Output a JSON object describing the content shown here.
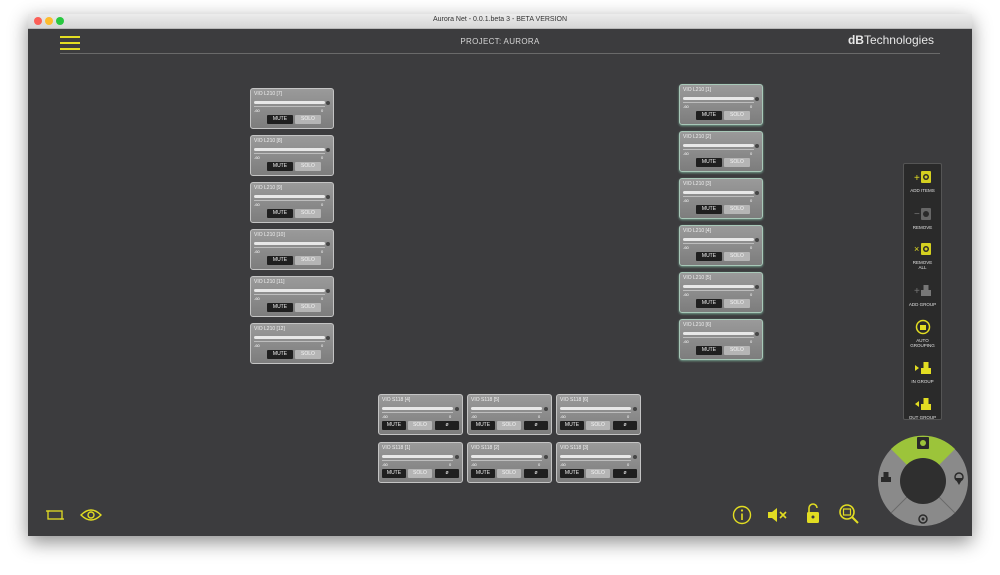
{
  "window": {
    "title": "Aurora Net - 0.0.1.beta 3 - BETA VERSION"
  },
  "header": {
    "project": "PROJECT: AURORA",
    "brand_bold": "dB",
    "brand_rest": "Technologies"
  },
  "colors": {
    "accent": "#e2dd22",
    "background": "#3c3c3e",
    "toolbar": "#2a2a2a",
    "module_glow": "#a8c8b8"
  },
  "module_common": {
    "min_label": "-60",
    "max_label": "0",
    "mute_label": "MUTE",
    "solo_label": "SOLO",
    "phase_label": "ø"
  },
  "left_column": [
    {
      "title": "VIO L210 [7]"
    },
    {
      "title": "VIO L210 [8]"
    },
    {
      "title": "VIO L210 [9]"
    },
    {
      "title": "VIO L210 [10]"
    },
    {
      "title": "VIO L210 [11]"
    },
    {
      "title": "VIO L210 [12]"
    }
  ],
  "right_column": [
    {
      "title": "VIO L210 [1]"
    },
    {
      "title": "VIO L210 [2]"
    },
    {
      "title": "VIO L210 [3]"
    },
    {
      "title": "VIO L210 [4]"
    },
    {
      "title": "VIO L210 [5]"
    },
    {
      "title": "VIO L210 [6]"
    }
  ],
  "subs": [
    {
      "title": "VIO S118 [4]"
    },
    {
      "title": "VIO S118 [5]"
    },
    {
      "title": "VIO S118 [6]"
    },
    {
      "title": "VIO S118 [1]"
    },
    {
      "title": "VIO S118 [2]"
    },
    {
      "title": "VIO S118 [3]"
    }
  ],
  "toolbar": {
    "add_items": "ADD ITEMS",
    "remove": "REMOVE",
    "remove_all_1": "REMOVE",
    "remove_all_2": "ALL",
    "add_group": "ADD GROUP",
    "auto_grouping_1": "AUTO",
    "auto_grouping_2": "GROUPING",
    "in_group": "IN GROUP",
    "out_group": "OUT GROUP"
  },
  "icons": {
    "menu": "hamburger-icon",
    "fit": "fit-screen-icon",
    "view": "eye-icon",
    "info": "info-icon",
    "mute_all": "speaker-mute-icon",
    "lock": "unlock-icon",
    "zoom": "zoom-icon"
  }
}
